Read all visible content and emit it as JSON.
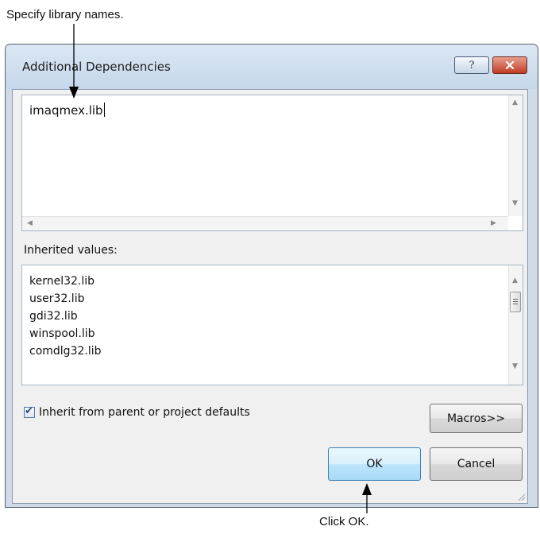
{
  "annotations": {
    "top": "Specify library names.",
    "bottom": "Click OK."
  },
  "dialog": {
    "title": "Additional Dependencies",
    "help_glyph": "?",
    "close_glyph": "✕"
  },
  "textbox": {
    "value": "imaqmex.lib"
  },
  "inherited": {
    "label": "Inherited values:",
    "items": [
      "kernel32.lib",
      "user32.lib",
      "gdi32.lib",
      "winspool.lib",
      "comdlg32.lib"
    ]
  },
  "inherit_checkbox": {
    "label": "Inherit from parent or project defaults",
    "checked": true
  },
  "buttons": {
    "macros": "Macros>>",
    "ok": "OK",
    "cancel": "Cancel"
  }
}
